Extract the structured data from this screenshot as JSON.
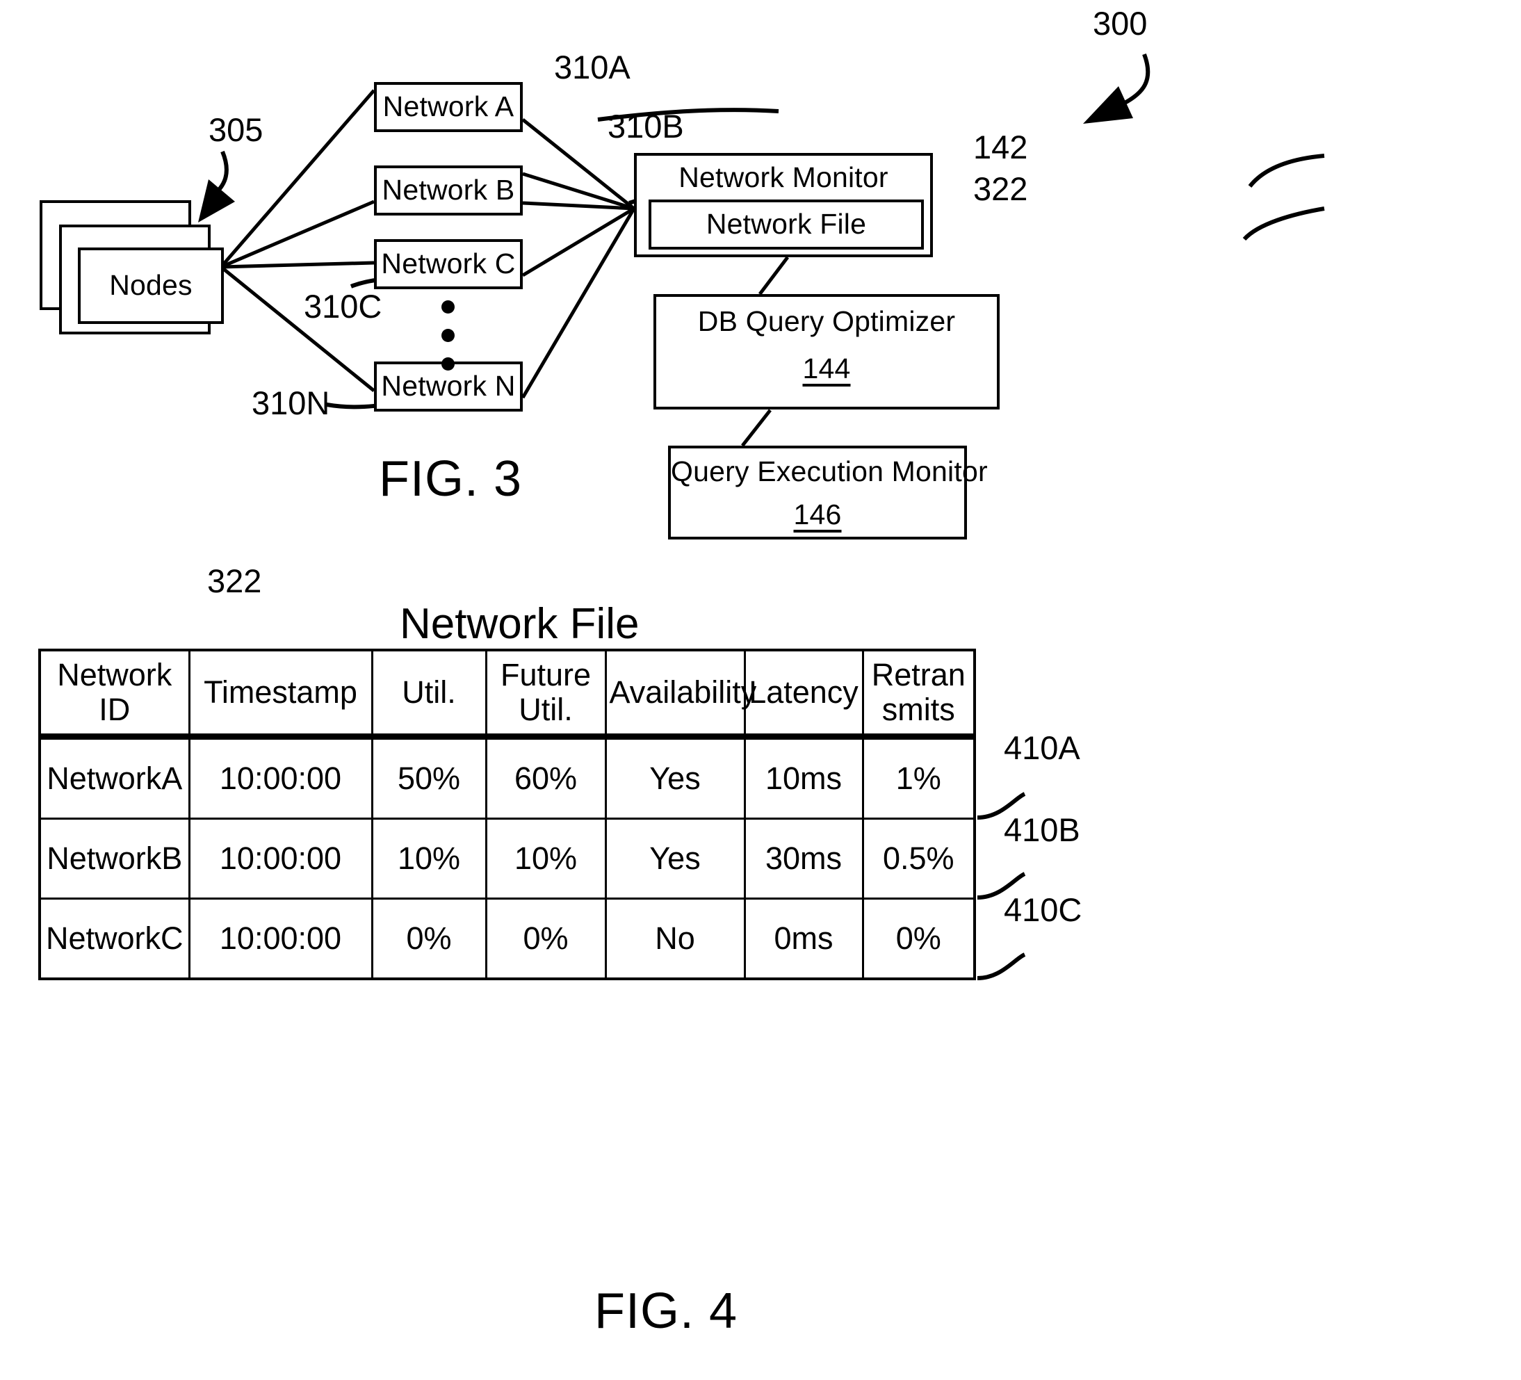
{
  "figure3": {
    "caption": "FIG. 3",
    "system_ref": "300",
    "nodes_block": {
      "label": "Nodes",
      "ref": "305"
    },
    "networks": [
      {
        "label": "Network A",
        "ref": "310A"
      },
      {
        "label": "Network B",
        "ref": "310B"
      },
      {
        "label": "Network C",
        "ref": "310C"
      },
      {
        "label": "Network N",
        "ref": "310N"
      }
    ],
    "network_monitor": {
      "label": "Network Monitor",
      "ref": "142",
      "inner": {
        "label": "Network File",
        "ref": "322"
      }
    },
    "db_query_optimizer": {
      "label": "DB Query Optimizer",
      "ref": "144"
    },
    "query_execution_monitor": {
      "label": "Query Execution Monitor",
      "ref": "146"
    }
  },
  "figure4": {
    "caption": "FIG. 4",
    "title": "Network File",
    "title_ref": "322",
    "table": {
      "columns": [
        "Network ID",
        "Timestamp",
        "Util.",
        "Future Util.",
        "Availability",
        "Latency",
        "Retran smits"
      ],
      "rows": [
        {
          "ref": "410A",
          "cells": [
            "NetworkA",
            "10:00:00",
            "50%",
            "60%",
            "Yes",
            "10ms",
            "1%"
          ]
        },
        {
          "ref": "410B",
          "cells": [
            "NetworkB",
            "10:00:00",
            "10%",
            "10%",
            "Yes",
            "30ms",
            "0.5%"
          ]
        },
        {
          "ref": "410C",
          "cells": [
            "NetworkC",
            "10:00:00",
            "0%",
            "0%",
            "No",
            "0ms",
            "0%"
          ]
        }
      ]
    }
  },
  "colors": {
    "ink": "#000000",
    "paper": "#ffffff"
  }
}
